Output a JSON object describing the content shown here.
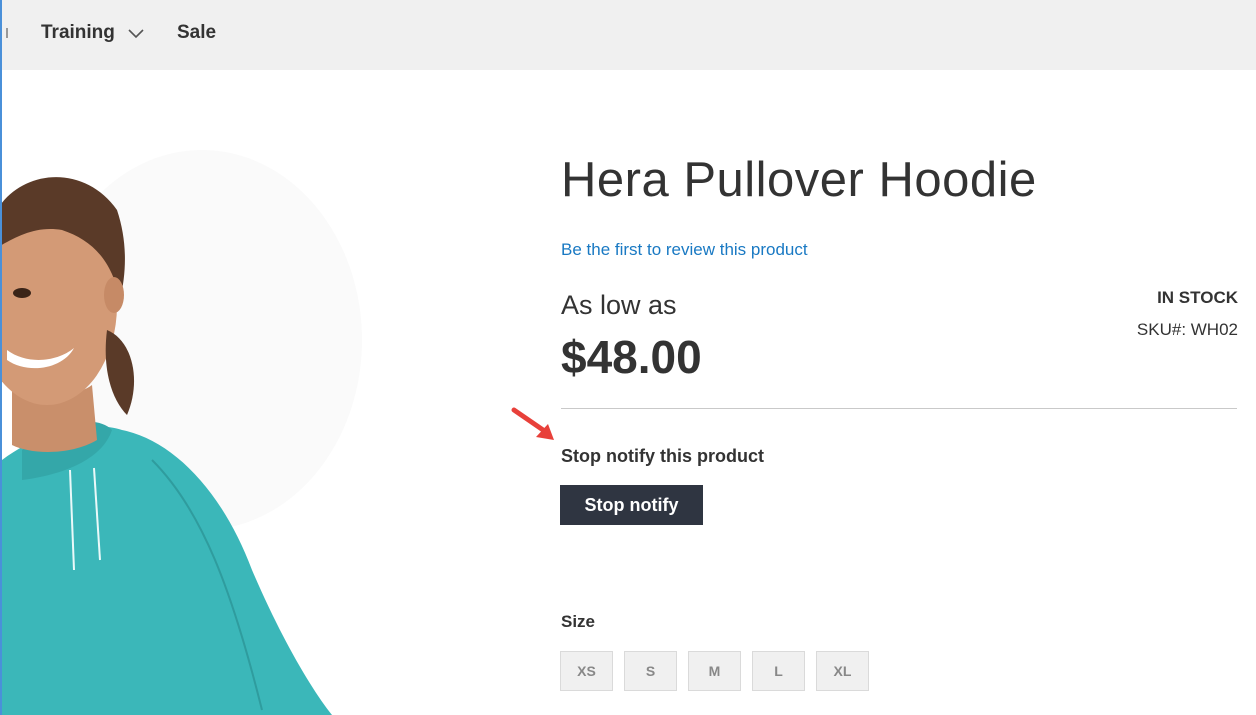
{
  "nav": {
    "items": [
      {
        "label": "Training",
        "icon": "chevron-down-icon"
      },
      {
        "label": "Sale"
      }
    ]
  },
  "product": {
    "title": "Hera Pullover Hoodie",
    "review_link": "Be the first to review this product",
    "price_prefix": "As low as",
    "price": "$48.00",
    "stock_status": "IN STOCK",
    "sku": "SKU#:  WH02",
    "image_colors": {
      "hoodie": "#3bb7b9",
      "skin": "#c98f6b",
      "hair": "#5a3a28"
    }
  },
  "notify": {
    "label": "Stop notify this product",
    "button_label": "Stop notify",
    "button_color": "#2f3541",
    "arrow_color": "#e8403a"
  },
  "options": {
    "size_label": "Size",
    "sizes": [
      "XS",
      "S",
      "M",
      "L",
      "XL"
    ]
  },
  "colors": {
    "link": "#1979c3",
    "navbar_bg": "#f0f0f0"
  }
}
